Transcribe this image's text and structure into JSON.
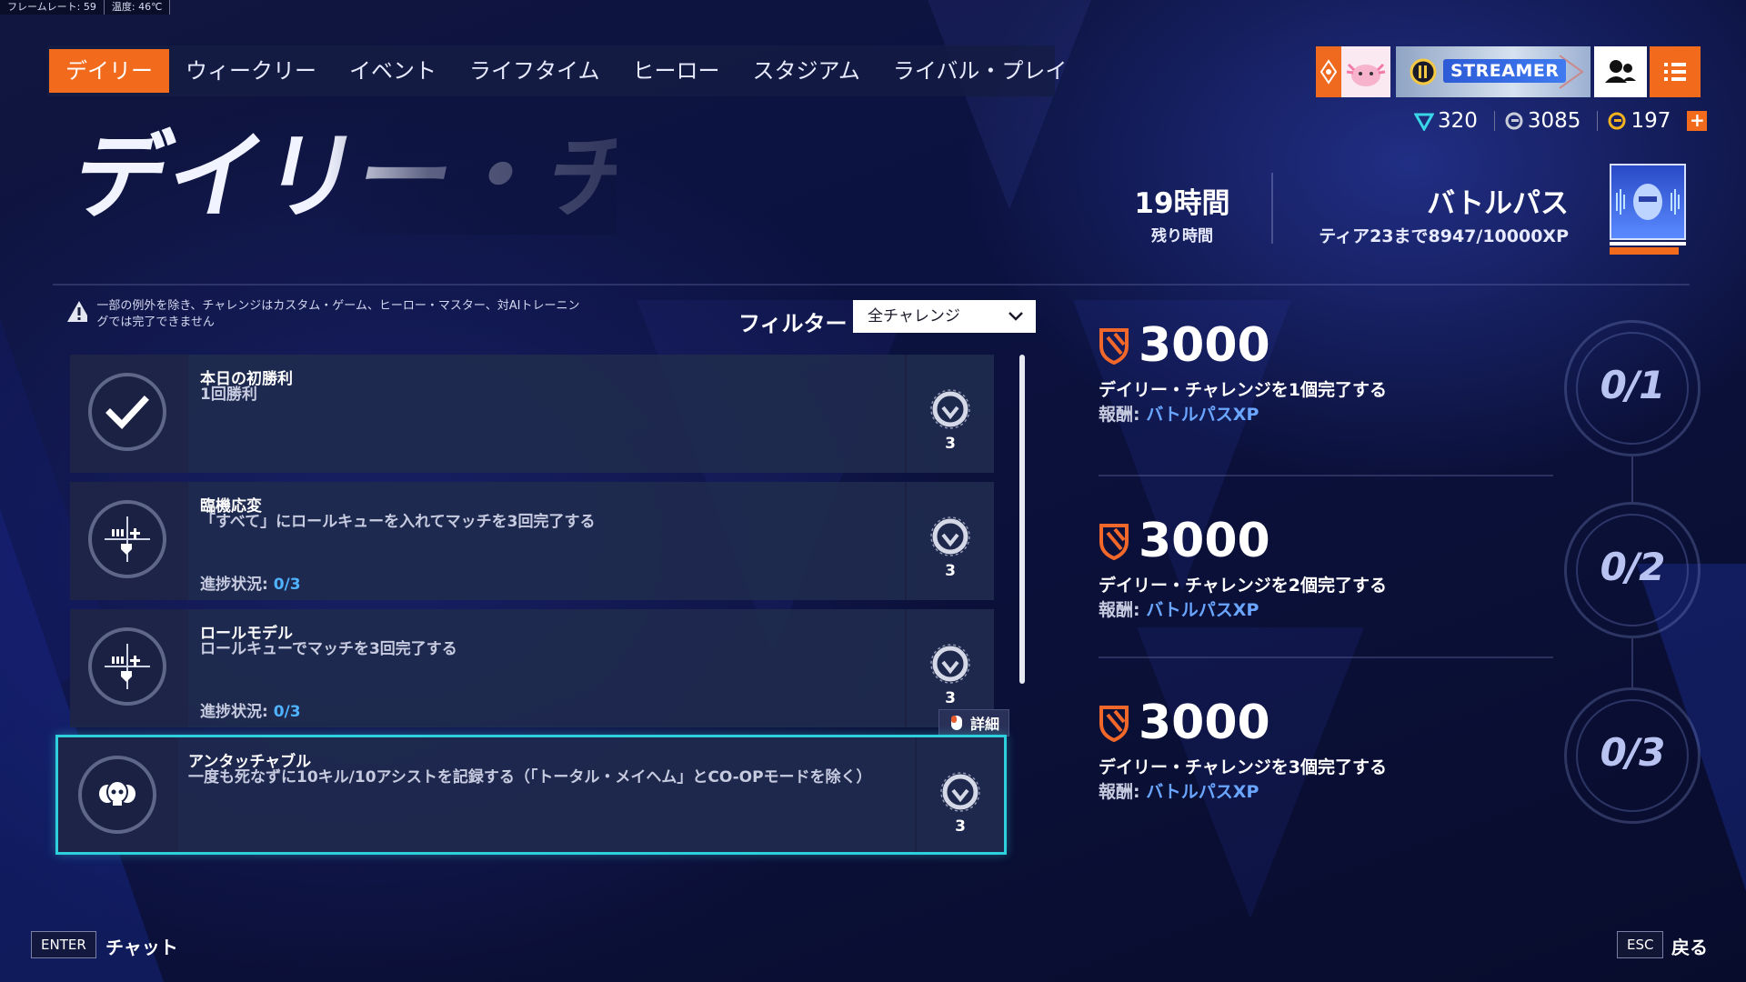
{
  "status": {
    "framerate": "フレームレート: 59",
    "temperature": "温度: 46℃"
  },
  "nav": {
    "tabs": [
      {
        "label": "デイリー",
        "active": true
      },
      {
        "label": "ウィークリー",
        "active": false
      },
      {
        "label": "イベント",
        "active": false
      },
      {
        "label": "ライフタイム",
        "active": false
      },
      {
        "label": "ヒーロー",
        "active": false
      },
      {
        "label": "スタジアム",
        "active": false
      },
      {
        "label": "ライバル・プレイ",
        "active": false
      }
    ]
  },
  "header": {
    "streamer_label": "STREAMER",
    "currency": {
      "legacy_credits": "320",
      "credits": "3085",
      "coins": "197",
      "plus": "+"
    },
    "page_title": "デイリー・チャレンジ"
  },
  "timer": {
    "value": "19時間",
    "label": "残り時間"
  },
  "battle_pass": {
    "title": "バトルパス",
    "progress": "ティア23まで8947/10000XP"
  },
  "notice": {
    "text": "一部の例外を除き、チャレンジはカスタム・ゲーム、ヒーロー・マスター、対AIトレーニングでは完了できません"
  },
  "filter": {
    "label": "フィルター",
    "selected": "全チャレンジ"
  },
  "challenges": [
    {
      "title": "本日の初勝利",
      "description": "1回勝利",
      "progress_label": "",
      "progress_value": "",
      "reward": "3",
      "icon": "checkmark-icon",
      "completed": true
    },
    {
      "title": "臨機応変",
      "description": "「すべて」にロールキューを入れてマッチを3回完了する",
      "progress_label": "進捗状況: ",
      "progress_value": "0/3",
      "reward": "3",
      "icon": "role-queue-icon",
      "completed": false
    },
    {
      "title": "ロールモデル",
      "description": "ロールキューでマッチを3回完了する",
      "progress_label": "進捗状況: ",
      "progress_value": "0/3",
      "reward": "3",
      "icon": "role-queue-icon",
      "completed": false
    },
    {
      "title": "アンタッチャブル",
      "description": "一度も死なずに10キル/10アシストを記録する（「トータル・メイヘム」とCO-OPモードを除く）",
      "progress_label": "",
      "progress_value": "",
      "reward": "3",
      "icon": "skulls-icon",
      "completed": false,
      "selected": true
    }
  ],
  "detail_button": {
    "label": "詳細"
  },
  "milestones": [
    {
      "xp": "3000",
      "description": "デイリー・チャレンジを1個完了する",
      "reward_label": "報酬: ",
      "reward_value": "バトルパスXP",
      "progress": "0/1"
    },
    {
      "xp": "3000",
      "description": "デイリー・チャレンジを2個完了する",
      "reward_label": "報酬: ",
      "reward_value": "バトルパスXP",
      "progress": "0/2"
    },
    {
      "xp": "3000",
      "description": "デイリー・チャレンジを3個完了する",
      "reward_label": "報酬: ",
      "reward_value": "バトルパスXP",
      "progress": "0/3"
    }
  ],
  "footer": {
    "enter_key": "ENTER",
    "enter_label": "チャット",
    "esc_key": "ESC",
    "esc_label": "戻る"
  },
  "colors": {
    "accent_orange": "#f26b1d",
    "selected_outline": "#2fd0dd",
    "progress_blue": "#4fb3ff"
  }
}
